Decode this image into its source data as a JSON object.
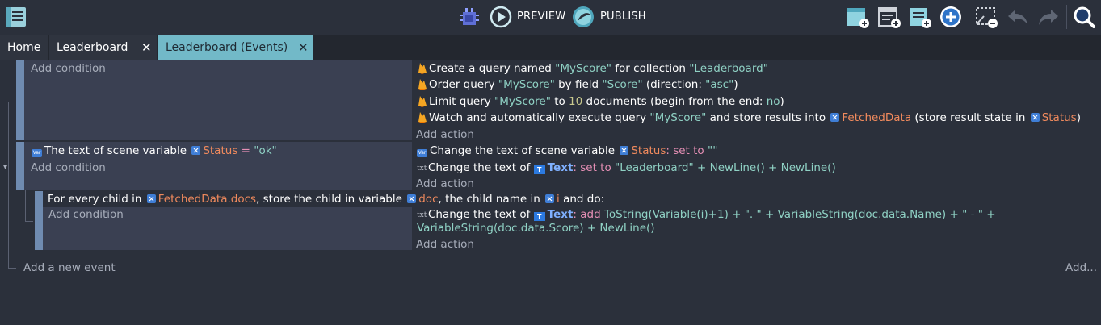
{
  "toolbar": {
    "preview_label": "PREVIEW",
    "publish_label": "PUBLISH",
    "colors": {
      "bg": "#2b303b",
      "accent": "#72b9c8"
    }
  },
  "tabs": [
    {
      "label": "Home"
    },
    {
      "label": "Leaderboard"
    },
    {
      "label": "Leaderboard (Events)",
      "active": true
    }
  ],
  "events": {
    "add_condition": "Add condition",
    "add_action": "Add action",
    "add_new_event": "Add a new event",
    "add_menu": "Add...",
    "event1": {
      "actions": [
        {
          "p1": "Create a query named ",
          "q1": "\"MyScore\"",
          "p2": " for collection ",
          "q2": "\"Leaderboard\""
        },
        {
          "p1": "Order query ",
          "q1": "\"MyScore\"",
          "p2": " by field ",
          "q2": "\"Score\"",
          "p3": " (direction: ",
          "q3": "\"asc\"",
          "p4": ")"
        },
        {
          "p1": "Limit query ",
          "q1": "\"MyScore\"",
          "p2": " to ",
          "n1": "10",
          "p3": " documents (begin from the end: ",
          "q3": "no",
          "p4": ")"
        },
        {
          "p1": "Watch and automatically execute query ",
          "q1": "\"MyScore\"",
          "p2": " and store results into ",
          "v1": "FetchedData",
          "p3": " (store result state in ",
          "v2": "Status",
          "p4": ")"
        }
      ]
    },
    "event2": {
      "condition": {
        "p1": "The text of scene variable ",
        "v1": "Status",
        "op": " = ",
        "q1": "\"ok\""
      },
      "actions": [
        {
          "p1": "Change the text of scene variable ",
          "v1": "Status",
          "k1": ": set to ",
          "q1": "\"\""
        },
        {
          "p1": "Change the text of ",
          "o1": "Text",
          "k1": ": set to ",
          "q1": "\"Leaderboard\" + NewLine() + NewLine()"
        }
      ]
    },
    "event3": {
      "header": {
        "p1": "For every child in ",
        "v1": "FetchedData.docs",
        "p2": ", store the child in variable ",
        "v2": "doc",
        "p3": ", the child name in ",
        "v3": "i",
        "p4": " and do:"
      },
      "actions": [
        {
          "p1": "Change the text of ",
          "o1": "Text",
          "k1": ": add ",
          "q1": "ToString(Variable(i)+1) + \". \" + VariableString(doc.data.Name) + \" - \" +",
          "q2": "VariableString(doc.data.Score) + NewLine()"
        }
      ]
    }
  }
}
